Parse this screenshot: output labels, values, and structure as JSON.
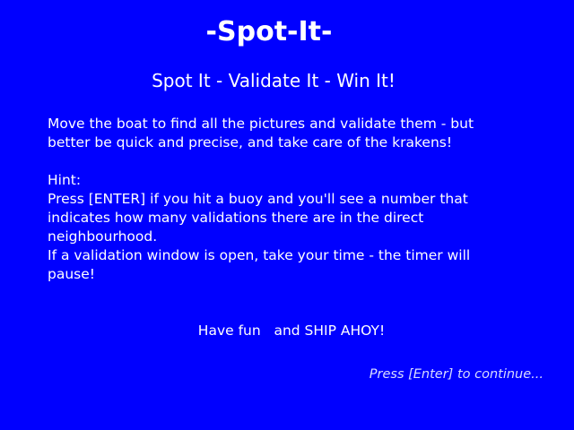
{
  "screen": {
    "background_color": "#0000ff",
    "text_color": "#ffffff",
    "title": "-Spot-It-",
    "subtitle": "Spot It - Validate It - Win It!",
    "intro": [
      "Move the boat to find all the pictures and validate them - but",
      "better be quick and precise, and take care of the krakens!"
    ],
    "hint_heading": "Hint:",
    "hint": [
      "Press [ENTER] if you hit a buoy and you'll see a number that",
      "indicates how many validations there are in the direct",
      "neighbourhood.",
      "If a validation window is open, take your time - the timer will",
      "pause!"
    ],
    "closing": "Have fun   and SHIP AHOY!",
    "continue_prompt": "Press [Enter] to continue..."
  }
}
